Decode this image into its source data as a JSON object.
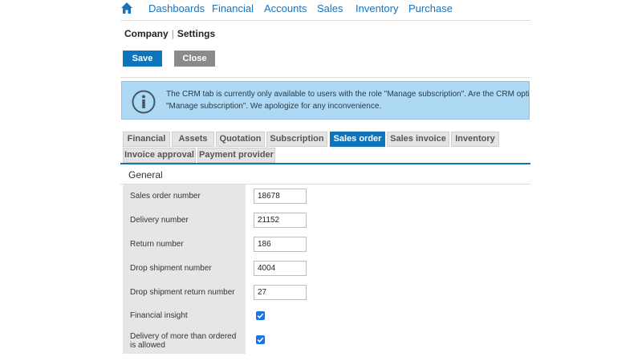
{
  "nav": {
    "items": [
      {
        "label": "Dashboards"
      },
      {
        "label": "Financial"
      },
      {
        "label": "Accounts"
      },
      {
        "label": "Sales"
      },
      {
        "label": "Inventory"
      },
      {
        "label": "Purchase"
      }
    ],
    "home_icon": "home-icon",
    "accent": "#1a72b8"
  },
  "breadcrumb": {
    "parent": "Company",
    "separator": "|",
    "current": "Settings"
  },
  "toolbar": {
    "save_label": "Save",
    "close_label": "Close",
    "save_color": "#0e74bc",
    "close_color": "#8a8a8a"
  },
  "info": {
    "icon": "info-icon",
    "line1": "The CRM tab is currently only available to users with the role \"Manage subscription\". Are the CRM options",
    "line2": "\"Manage subscription\". We apologize for any inconvenience.",
    "background": "#aed9f4"
  },
  "tabs": [
    {
      "label": "Financial"
    },
    {
      "label": "Assets"
    },
    {
      "label": "Quotation"
    },
    {
      "label": "Subscription"
    },
    {
      "label": "Sales order",
      "active": true
    },
    {
      "label": "Sales invoice"
    },
    {
      "label": "Inventory"
    },
    {
      "label": "Invoice approval"
    },
    {
      "label": "Payment provider"
    }
  ],
  "section": {
    "title": "General",
    "fields": [
      {
        "label": "Sales order number",
        "value": "18678"
      },
      {
        "label": "Delivery number",
        "value": "21152"
      },
      {
        "label": "Return number",
        "value": "186"
      },
      {
        "label": "Drop shipment number",
        "value": "4004"
      },
      {
        "label": "Drop shipment return number",
        "value": "27"
      }
    ],
    "checkboxes": [
      {
        "label_line1": "Financial insight",
        "label_line2": "",
        "checked": true
      },
      {
        "label_line1": "Delivery of more than ordered",
        "label_line2": "is allowed",
        "checked": true
      }
    ]
  }
}
